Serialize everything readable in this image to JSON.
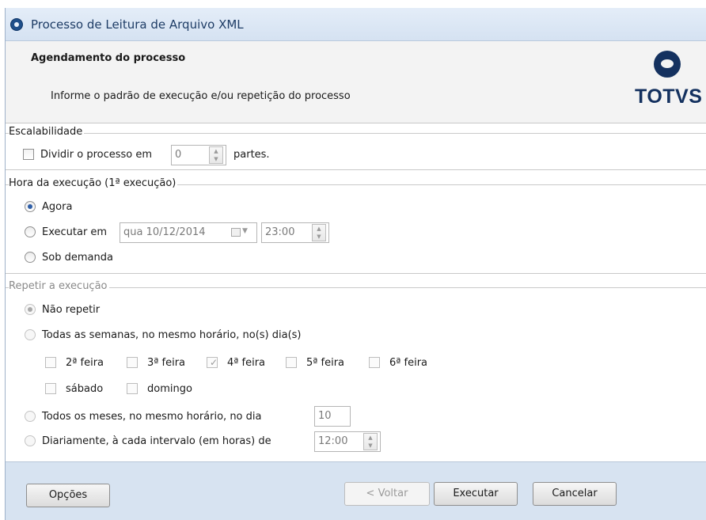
{
  "window": {
    "title": "Processo de Leitura de Arquivo XML"
  },
  "header": {
    "title": "Agendamento do processo",
    "subtitle": "Informe o padrão de execução e/ou repetição do processo",
    "logo_text": "TOTVS"
  },
  "scalability": {
    "section_title": "Escalabilidade",
    "divide_label": "Dividir o processo em",
    "divide_checked": false,
    "parts_value": "0",
    "parts_suffix": "partes."
  },
  "execution_time": {
    "section_title": "Hora da execução (1ª execução)",
    "options": [
      {
        "label": "Agora",
        "selected": true
      },
      {
        "label": "Executar em",
        "selected": false
      },
      {
        "label": "Sob demanda",
        "selected": false
      }
    ],
    "date_value": "qua 10/12/2014",
    "time_value": "23:00"
  },
  "repeat": {
    "section_title": "Repetir a execução",
    "options": [
      {
        "label": "Não repetir",
        "selected": true
      },
      {
        "label": "Todas as semanas, no mesmo horário, no(s) dia(s)",
        "selected": false
      },
      {
        "label": "Todos os meses, no mesmo horário, no dia",
        "selected": false
      },
      {
        "label": "Diariamente, à cada intervalo (em horas) de",
        "selected": false
      }
    ],
    "weekdays": [
      {
        "label": "2ª feira",
        "checked": false
      },
      {
        "label": "3ª feira",
        "checked": false
      },
      {
        "label": "4ª feira",
        "checked": true
      },
      {
        "label": "5ª feira",
        "checked": false
      },
      {
        "label": "6ª feira",
        "checked": false
      },
      {
        "label": "sábado",
        "checked": false
      },
      {
        "label": "domingo",
        "checked": false
      }
    ],
    "month_day_value": "10",
    "interval_value": "12:00"
  },
  "footer": {
    "options_label": "Opções",
    "back_label": "< Voltar",
    "execute_label": "Executar",
    "cancel_label": "Cancelar"
  }
}
